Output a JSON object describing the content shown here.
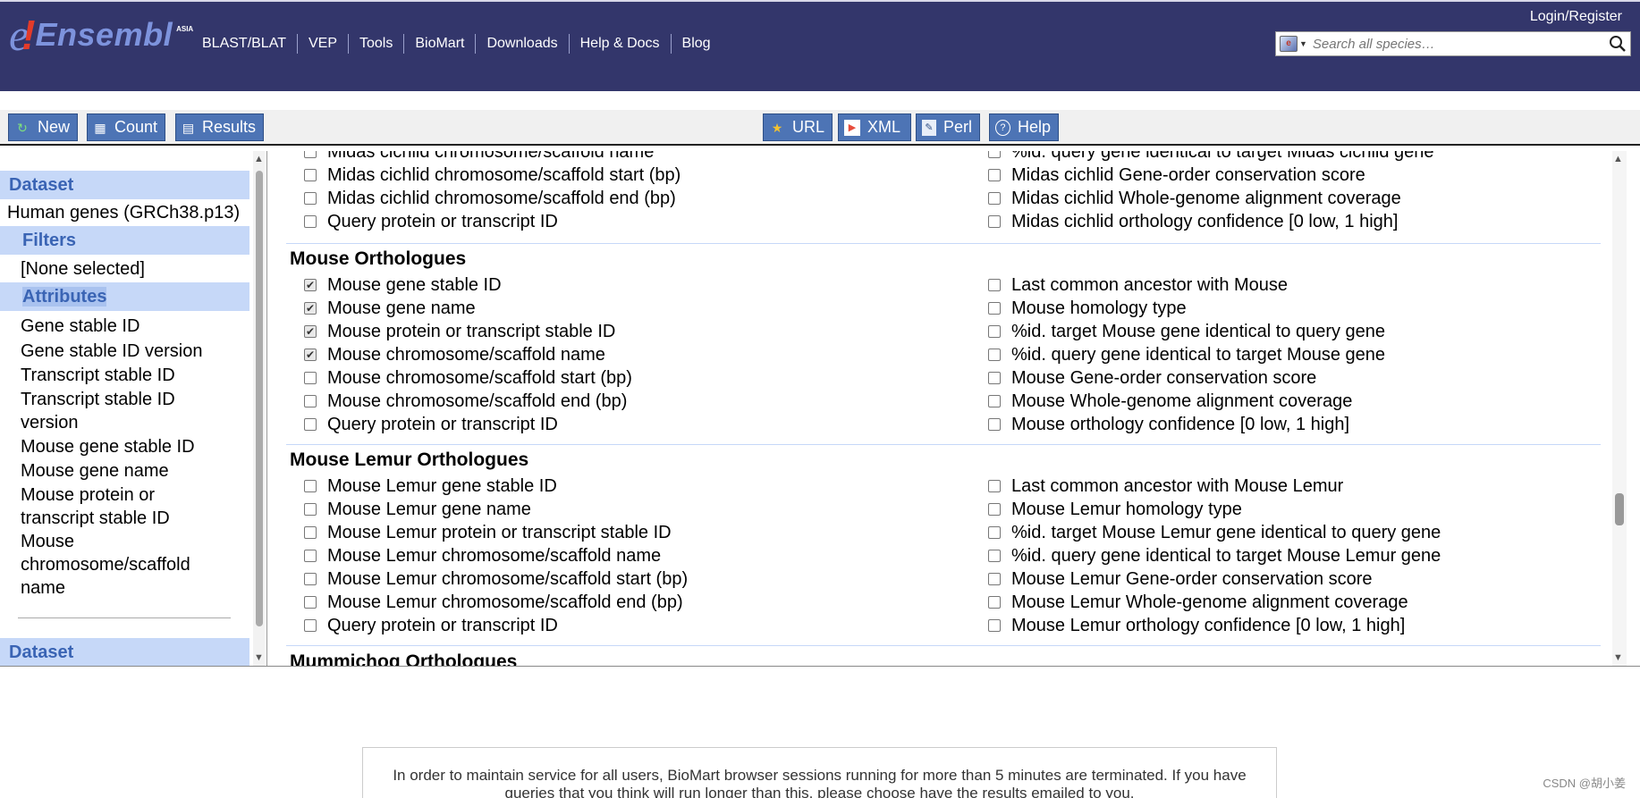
{
  "header": {
    "logo": {
      "e": "e",
      "bang": "!",
      "name": "Ensembl",
      "region": "ASIA"
    },
    "nav": [
      "BLAST/BLAT",
      "VEP",
      "Tools",
      "BioMart",
      "Downloads",
      "Help & Docs",
      "Blog"
    ],
    "login": "Login/Register",
    "search_placeholder": "Search all species…"
  },
  "toolbar": {
    "new": "New",
    "count": "Count",
    "results": "Results",
    "url": "URL",
    "xml": "XML",
    "perl": "Perl",
    "help": "Help"
  },
  "sidebar": {
    "dataset_label": "Dataset",
    "dataset_value": "Human genes (GRCh38.p13)",
    "filters_label": "Filters",
    "filters_value": "[None selected]",
    "attributes_label": "Attributes",
    "attributes": [
      "Gene stable ID",
      "Gene stable ID version",
      "Transcript stable ID",
      "Transcript stable ID",
      "version",
      "Mouse gene stable ID",
      "Mouse gene name",
      "Mouse protein or",
      "transcript stable ID",
      "Mouse",
      "chromosome/scaffold",
      "name"
    ],
    "dataset2_label": "Dataset"
  },
  "main": {
    "top_partial": {
      "left": [
        {
          "label": "Midas cichlid chromosome/scaffold name",
          "checked": false
        },
        {
          "label": "Midas cichlid chromosome/scaffold start (bp)",
          "checked": false
        },
        {
          "label": "Midas cichlid chromosome/scaffold end (bp)",
          "checked": false
        },
        {
          "label": "Query protein or transcript ID",
          "checked": false
        }
      ],
      "right": [
        {
          "label": "%id. query gene identical to target Midas cichlid gene",
          "checked": false
        },
        {
          "label": "Midas cichlid Gene-order conservation score",
          "checked": false
        },
        {
          "label": "Midas cichlid Whole-genome alignment coverage",
          "checked": false
        },
        {
          "label": "Midas cichlid orthology confidence [0 low, 1 high]",
          "checked": false
        }
      ]
    },
    "mouse": {
      "title": "Mouse Orthologues",
      "left": [
        {
          "label": "Mouse gene stable ID",
          "checked": true
        },
        {
          "label": "Mouse gene name",
          "checked": true
        },
        {
          "label": "Mouse protein or transcript stable ID",
          "checked": true
        },
        {
          "label": "Mouse chromosome/scaffold name",
          "checked": true
        },
        {
          "label": "Mouse chromosome/scaffold start (bp)",
          "checked": false
        },
        {
          "label": "Mouse chromosome/scaffold end (bp)",
          "checked": false
        },
        {
          "label": "Query protein or transcript ID",
          "checked": false
        }
      ],
      "right": [
        {
          "label": "Last common ancestor with Mouse",
          "checked": false
        },
        {
          "label": "Mouse homology type",
          "checked": false
        },
        {
          "label": "%id. target Mouse gene identical to query gene",
          "checked": false
        },
        {
          "label": "%id. query gene identical to target Mouse gene",
          "checked": false
        },
        {
          "label": "Mouse Gene-order conservation score",
          "checked": false
        },
        {
          "label": "Mouse Whole-genome alignment coverage",
          "checked": false
        },
        {
          "label": "Mouse orthology confidence [0 low, 1 high]",
          "checked": false
        }
      ]
    },
    "lemur": {
      "title": "Mouse Lemur Orthologues",
      "left": [
        {
          "label": "Mouse Lemur gene stable ID",
          "checked": false
        },
        {
          "label": "Mouse Lemur gene name",
          "checked": false
        },
        {
          "label": "Mouse Lemur protein or transcript stable ID",
          "checked": false
        },
        {
          "label": "Mouse Lemur chromosome/scaffold name",
          "checked": false
        },
        {
          "label": "Mouse Lemur chromosome/scaffold start (bp)",
          "checked": false
        },
        {
          "label": "Mouse Lemur chromosome/scaffold end (bp)",
          "checked": false
        },
        {
          "label": "Query protein or transcript ID",
          "checked": false
        }
      ],
      "right": [
        {
          "label": "Last common ancestor with Mouse Lemur",
          "checked": false
        },
        {
          "label": "Mouse Lemur homology type",
          "checked": false
        },
        {
          "label": "%id. target Mouse Lemur gene identical to query gene",
          "checked": false
        },
        {
          "label": "%id. query gene identical to target Mouse Lemur gene",
          "checked": false
        },
        {
          "label": "Mouse Lemur Gene-order conservation score",
          "checked": false
        },
        {
          "label": "Mouse Lemur Whole-genome alignment coverage",
          "checked": false
        },
        {
          "label": "Mouse Lemur orthology confidence [0 low, 1 high]",
          "checked": false
        }
      ]
    },
    "next_title": "Mummichog Orthologues"
  },
  "notice": "In order to maintain service for all users, BioMart browser sessions running for more than 5 minutes are terminated. If you have queries that you think will run longer than this, please choose have the results emailed to you.",
  "watermark": "CSDN @胡小姜"
}
